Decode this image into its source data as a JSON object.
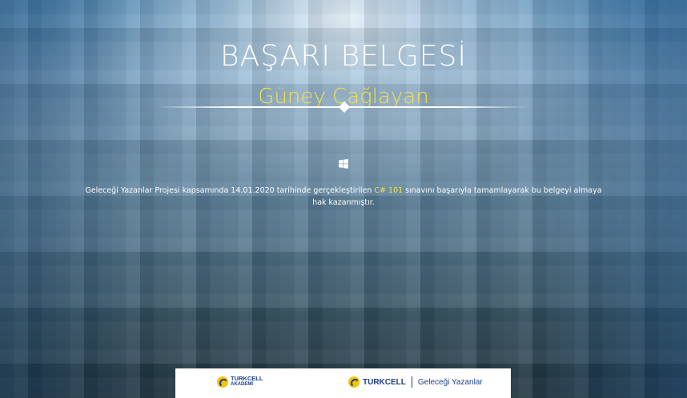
{
  "certificate": {
    "title": "BAŞARI BELGESİ",
    "recipient": "Güney Çağlayan",
    "description_before": "Geleceği Yazanlar Projesi kapsamında 14.01.2020 tarihinde gerçekleştirilen ",
    "course": "C# 101",
    "description_after": " sınavını başarıyla tamamlayarak bu belgeyi almaya hak kazanmıştır.",
    "icon": "windows-icon"
  },
  "footer": {
    "logo_left": {
      "brand": "TURKCELL",
      "sub": "AKADEMİ",
      "icon": "turkcell-icon"
    },
    "logo_right": {
      "brand": "TURKCELL",
      "program": "Geleceği Yazanlar",
      "icon": "turkcell-icon"
    }
  },
  "colors": {
    "accent": "#f4e04a",
    "brand_blue": "#1d3e8a",
    "brand_yellow": "#f5c400"
  }
}
